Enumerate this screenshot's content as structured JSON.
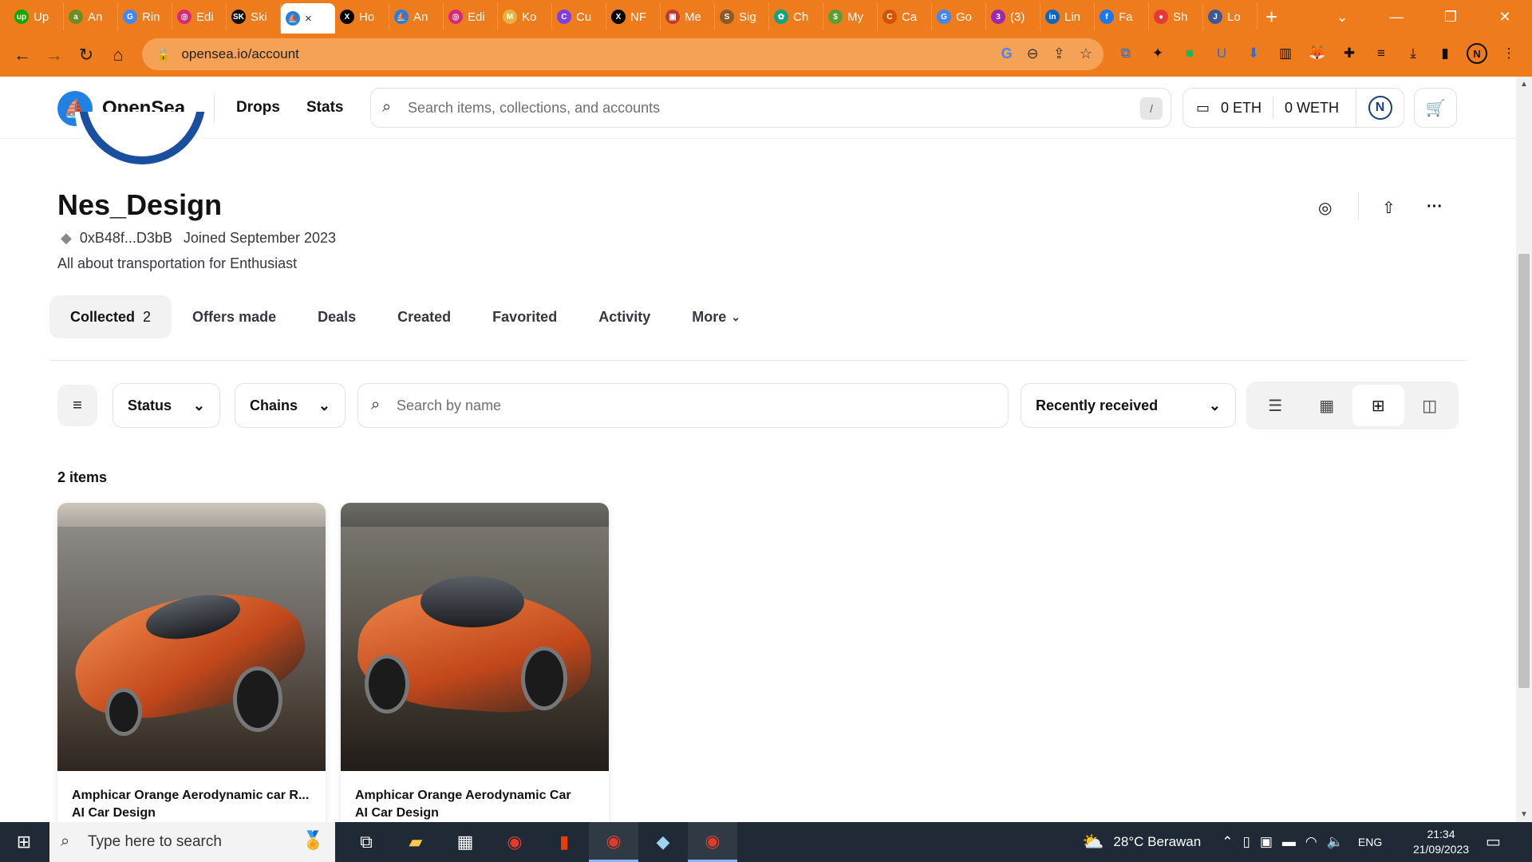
{
  "browser": {
    "tabs": [
      {
        "label": "Up",
        "color": "#14a800",
        "glyph": "up"
      },
      {
        "label": "An",
        "color": "#6b8e23",
        "glyph": "a"
      },
      {
        "label": "Rin",
        "color": "#4285f4",
        "glyph": "G"
      },
      {
        "label": "Edi",
        "color": "#d62976",
        "glyph": "◎"
      },
      {
        "label": "Ski",
        "color": "#111111",
        "glyph": "SK"
      },
      {
        "label": "×",
        "color": "#2081e2",
        "glyph": "⛵"
      },
      {
        "label": "Ho",
        "color": "#000000",
        "glyph": "X"
      },
      {
        "label": "An",
        "color": "#2081e2",
        "glyph": "⛵"
      },
      {
        "label": "Edi",
        "color": "#d62976",
        "glyph": "◎"
      },
      {
        "label": "Ko",
        "color": "#e8b33c",
        "glyph": "M"
      },
      {
        "label": "Cu",
        "color": "#7b3fe4",
        "glyph": "C"
      },
      {
        "label": "NF",
        "color": "#000000",
        "glyph": "X"
      },
      {
        "label": "Me",
        "color": "#c0392b",
        "glyph": "▣"
      },
      {
        "label": "Sig",
        "color": "#8a5a2b",
        "glyph": "S"
      },
      {
        "label": "Ch",
        "color": "#10a37f",
        "glyph": "✿"
      },
      {
        "label": "My",
        "color": "#5a9e36",
        "glyph": "$"
      },
      {
        "label": "Ca",
        "color": "#d35400",
        "glyph": "C"
      },
      {
        "label": "Go",
        "color": "#4285f4",
        "glyph": "G"
      },
      {
        "label": "(3)",
        "color": "#9c27b0",
        "glyph": "3"
      },
      {
        "label": "Lin",
        "color": "#0a66c2",
        "glyph": "in"
      },
      {
        "label": "Fa",
        "color": "#1877f2",
        "glyph": "f"
      },
      {
        "label": "Sh",
        "color": "#e53935",
        "glyph": "●"
      },
      {
        "label": "Lo",
        "color": "#3b5998",
        "glyph": "J"
      }
    ],
    "new_tab": "+",
    "url": "opensea.io/account"
  },
  "header": {
    "brand": "OpenSea",
    "nav": [
      "Drops",
      "Stats"
    ],
    "search_placeholder": "Search items, collections, and accounts",
    "search_shortcut": "/",
    "eth_balance": "0 ETH",
    "weth_balance": "0 WETH",
    "avatar_letter": "N"
  },
  "profile": {
    "name": "Nes_Design",
    "address": "0xB48f...D3bB",
    "joined": "Joined September 2023",
    "bio": "All about transportation for Enthusiast"
  },
  "tabs": [
    {
      "label": "Collected",
      "count": "2",
      "active": true
    },
    {
      "label": "Offers made"
    },
    {
      "label": "Deals"
    },
    {
      "label": "Created"
    },
    {
      "label": "Favorited"
    },
    {
      "label": "Activity"
    },
    {
      "label": "More"
    }
  ],
  "filters": {
    "status_label": "Status",
    "chains_label": "Chains",
    "search_placeholder": "Search by name",
    "sort_label": "Recently received"
  },
  "items_count": "2 items",
  "items": [
    {
      "title": "Amphicar Orange Aerodynamic car R...",
      "collection": "AI Car Design"
    },
    {
      "title": "Amphicar Orange Aerodynamic Car",
      "collection": "AI Car Design"
    }
  ],
  "taskbar": {
    "search_placeholder": "Type here to search",
    "weather": "28°C  Berawan",
    "language": "ENG",
    "time": "21:34",
    "date": "21/09/2023"
  }
}
